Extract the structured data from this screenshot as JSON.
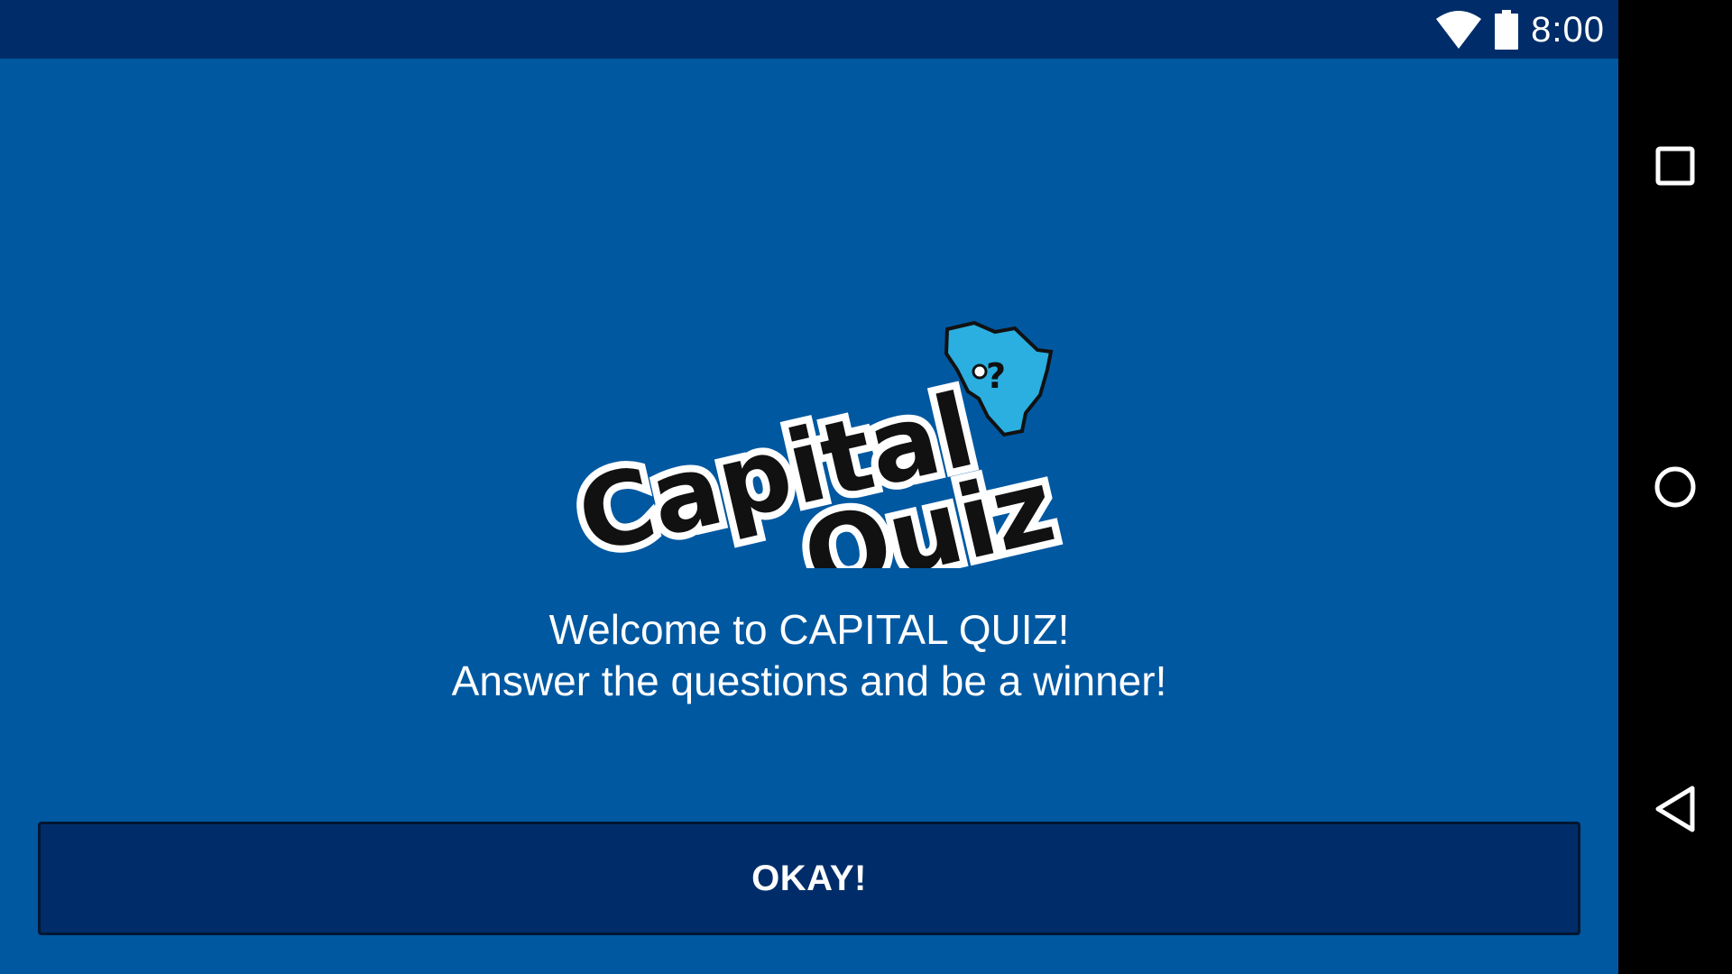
{
  "status_bar": {
    "time": "8:00",
    "wifi_icon": "wifi-icon",
    "battery_icon": "battery-icon"
  },
  "logo": {
    "line1": "Capital",
    "line2": "Quiz",
    "mark_icon": "africa-map-question-icon"
  },
  "welcome": {
    "line1": "Welcome to CAPITAL QUIZ!",
    "line2": "Answer the questions and be a winner!"
  },
  "okay_button": {
    "label": "OKAY!"
  },
  "nav_bar": {
    "recents_icon": "square-recents-icon",
    "home_icon": "circle-home-icon",
    "back_icon": "triangle-back-icon"
  },
  "colors": {
    "background": "#0058A1",
    "status_bar": "#002D69",
    "button": "#002D69",
    "text": "#FFFFFF",
    "logo_africa": "#2BAEE0"
  }
}
